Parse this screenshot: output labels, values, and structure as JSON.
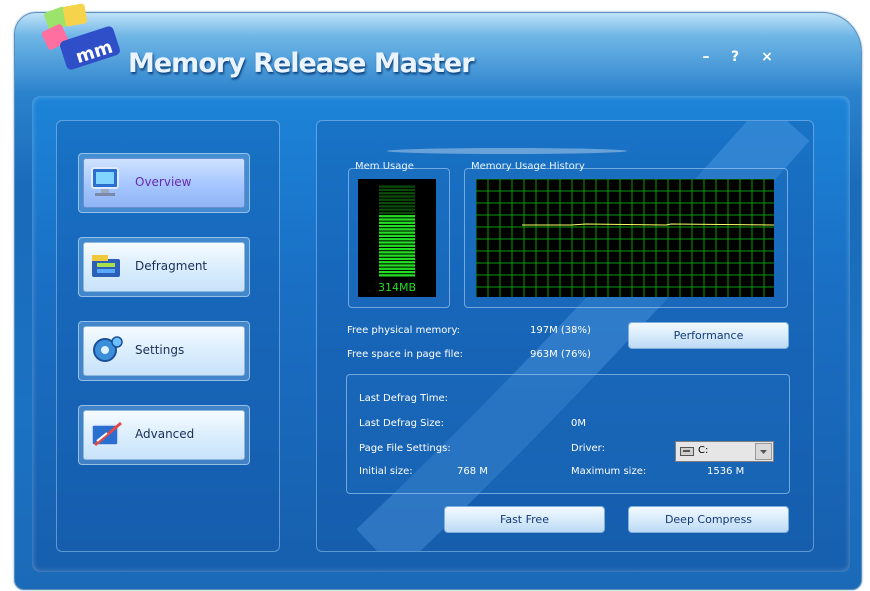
{
  "app": {
    "title": "Memory Release Master"
  },
  "window_controls": {
    "minimize": "–",
    "help": "?",
    "close": "×"
  },
  "nav": [
    {
      "label": "Overview",
      "icon": "monitor-icon",
      "active": true
    },
    {
      "label": "Defragment",
      "icon": "disk-icon",
      "active": false
    },
    {
      "label": "Settings",
      "icon": "gear-icon",
      "active": false
    },
    {
      "label": "Advanced",
      "icon": "tools-icon",
      "active": false
    }
  ],
  "mem_usage": {
    "caption": "Mem Usage",
    "value": "314MB",
    "level": 0.68
  },
  "history": {
    "caption": "Memory Usage History"
  },
  "stats": {
    "free_physical_label": "Free physical memory:",
    "free_physical_value": "197M (38%)",
    "free_page_label": "Free space in page file:",
    "free_page_value": "963M (76%)"
  },
  "buttons": {
    "performance": "Performance",
    "fast_free": "Fast Free",
    "deep_compress": "Deep Compress"
  },
  "defrag": {
    "last_time_label": "Last Defrag Time:",
    "last_size_label": "Last Defrag Size:",
    "last_size_value": "0M",
    "page_file_label": "Page File Settings:",
    "driver_label": "Driver:",
    "driver_value": "C:",
    "initial_label": "Initial size:",
    "initial_value": "768 M",
    "max_label": "Maximum size:",
    "max_value": "1536 M"
  },
  "colors": {
    "accent_green": "#22dd22",
    "grid_green": "#0a9a0a",
    "frame_blue": "#1a6fc4"
  }
}
